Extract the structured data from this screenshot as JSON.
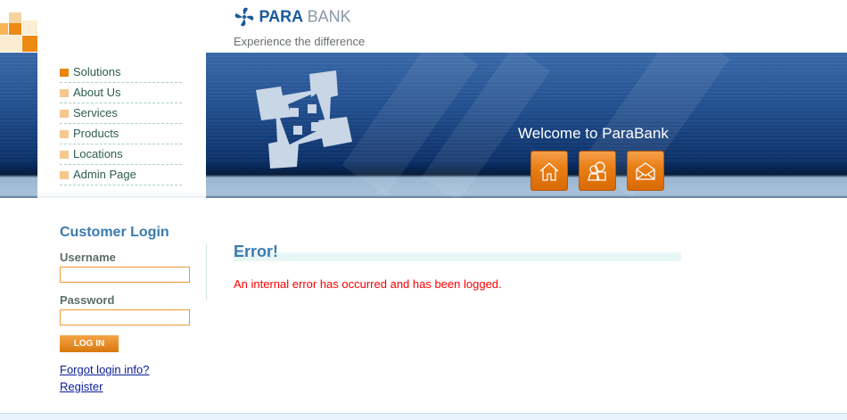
{
  "header": {
    "logo_primary": "PARA",
    "logo_secondary": "BANK",
    "tagline": "Experience the difference"
  },
  "banner": {
    "welcome": "Welcome to ParaBank",
    "icons": [
      "home-icon",
      "about-people-icon",
      "contact-envelope-icon"
    ]
  },
  "menu": {
    "items": [
      {
        "label": "Solutions",
        "active": true
      },
      {
        "label": "About Us"
      },
      {
        "label": "Services"
      },
      {
        "label": "Products"
      },
      {
        "label": "Locations"
      },
      {
        "label": "Admin Page"
      }
    ]
  },
  "login": {
    "title": "Customer Login",
    "username_label": "Username",
    "username_value": "",
    "password_label": "Password",
    "password_value": "",
    "login_button": "LOG IN",
    "forgot_link": "Forgot login info?",
    "register_link": "Register"
  },
  "main": {
    "title": "Error!",
    "message": "An internal error has occurred and has been logged."
  },
  "colors": {
    "accent": "#e9860a",
    "heading": "#3a7ab0",
    "error": "#ff0000",
    "banner": "#0c3068"
  }
}
